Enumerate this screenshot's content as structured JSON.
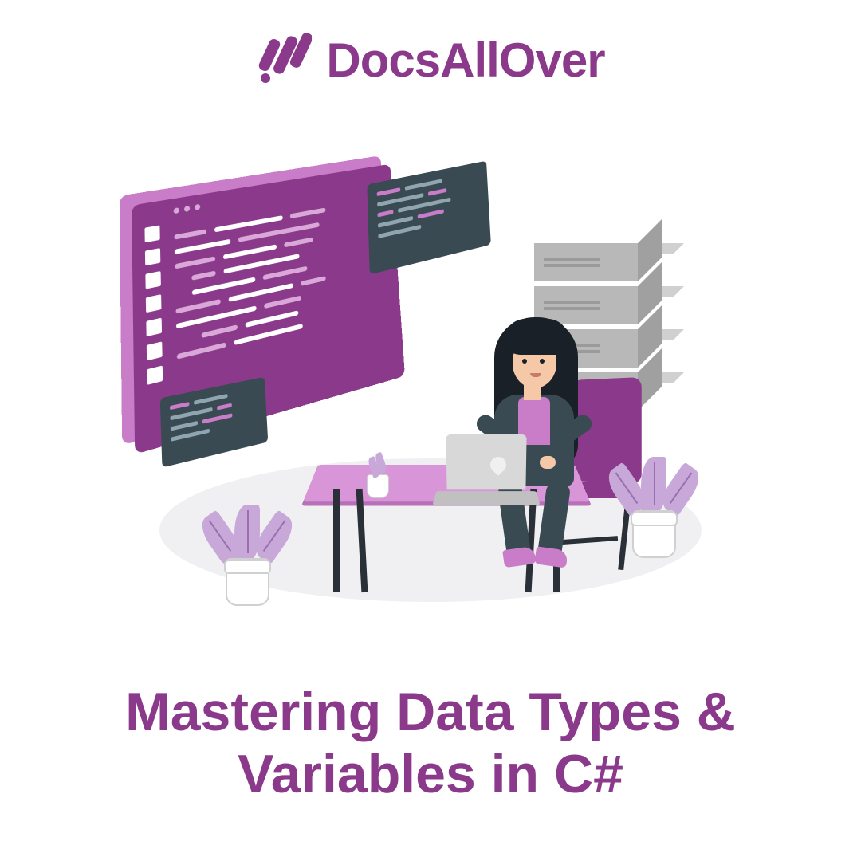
{
  "brand": {
    "name": "DocsAllOver",
    "logo_icon": "docsallover-logo-icon"
  },
  "title": "Mastering Data Types & Variables in C#",
  "colors": {
    "primary": "#8B3A8B",
    "accent_light": "#c97dc9",
    "panel_dark": "#3a4a52",
    "skin": "#f5c9a8",
    "hair": "#1a2028",
    "plant": "#c8a8d8",
    "server": "#b8b8b8"
  },
  "illustration": {
    "description": "Isometric illustration of a woman with long dark hair sitting at a pink desk with a laptop, facing a large purple code editor screen with two small dark code panels, a grey server stack behind her, a purple chair, and two potted plants on either side.",
    "elements": [
      "code-editor-screen",
      "mini-code-panel-top",
      "mini-code-panel-bottom",
      "server-stack",
      "woman-developer",
      "laptop",
      "desk",
      "chair",
      "plant-left",
      "plant-right",
      "desk-plant"
    ]
  }
}
